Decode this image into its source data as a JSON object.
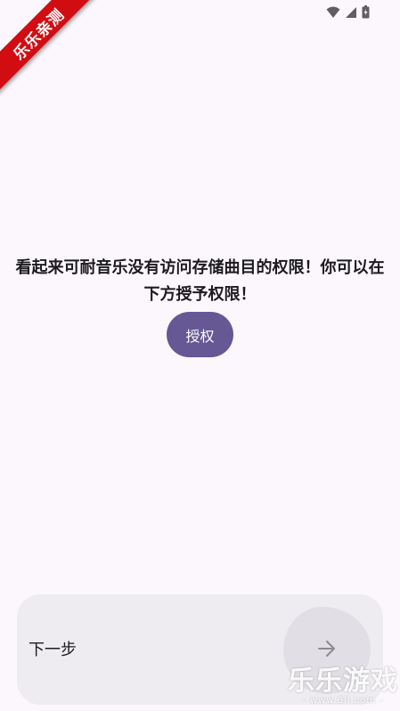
{
  "status_bar": {
    "icons": [
      "wifi-icon",
      "signal-icon",
      "battery-icon"
    ]
  },
  "watermark_ribbon": {
    "text": "乐乐亲测",
    "color": "#d20d12"
  },
  "permission": {
    "message": "看起来可耐音乐没有访问存储曲目的权限！你可以在下方授予权限！",
    "grant_label": "授权"
  },
  "bottom": {
    "next_label": "下一步",
    "next_icon": "arrow-right-icon"
  },
  "watermark_logo": {
    "title": "乐乐游戏",
    "url": "- www.6ll.com -"
  },
  "colors": {
    "background": "#fcf7fc",
    "accent": "#655894",
    "panel": "#efecf1"
  }
}
